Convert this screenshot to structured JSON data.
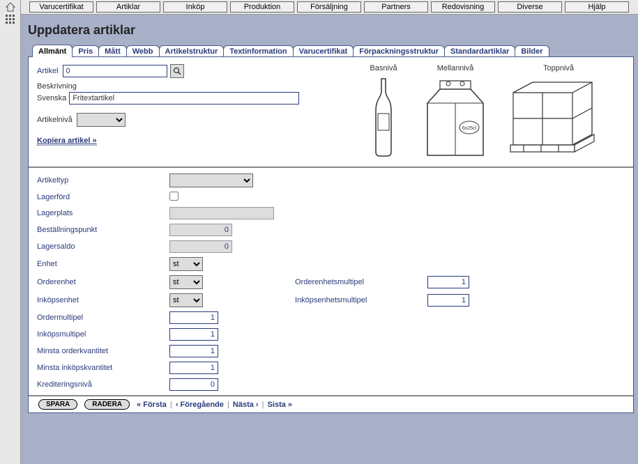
{
  "menubar": [
    "Varucertifikat",
    "Artiklar",
    "Inköp",
    "Produktion",
    "Försäljning",
    "Partners",
    "Redovisning",
    "Diverse",
    "Hjälp"
  ],
  "page_title": "Uppdatera artiklar",
  "tabs": [
    "Allmänt",
    "Pris",
    "Mått",
    "Webb",
    "Artikelstruktur",
    "Textinformation",
    "Varucertifikat",
    "Förpackningsstruktur",
    "Standardartiklar",
    "Bilder"
  ],
  "active_tab_index": 0,
  "upper": {
    "artikel_label": "Artikel",
    "artikel_value": "0",
    "beskrivning_label": "Beskrivning",
    "svenska_label": "Svenska",
    "svenska_value": "Fritextartikel",
    "artikelniva_label": "Artikelnivå",
    "kopiera_link": "Kopiera artikel »"
  },
  "levels": {
    "bas": "Basnivå",
    "mellan": "Mellannivå",
    "topp": "Toppnivå"
  },
  "fields": {
    "artikeltyp": {
      "label": "Artikeltyp"
    },
    "lagerford": {
      "label": "Lagerförd",
      "checked": false
    },
    "lagerplats": {
      "label": "Lagerplats",
      "value": ""
    },
    "bestallningspunkt": {
      "label": "Beställningspunkt",
      "value": "0"
    },
    "lagersaldo": {
      "label": "Lagersaldo",
      "value": "0"
    },
    "enhet": {
      "label": "Enhet",
      "value": "st"
    },
    "orderenhet": {
      "label": "Orderenhet",
      "value": "st"
    },
    "inkopsenhet": {
      "label": "Inköpsenhet",
      "value": "st"
    },
    "orderenhetsmultipel": {
      "label": "Orderenhetsmultipel",
      "value": "1"
    },
    "inkopsenhetsmultipel": {
      "label": "Inköpsenhetsmultipel",
      "value": "1"
    },
    "ordermultipel": {
      "label": "Ordermultipel",
      "value": "1"
    },
    "inkopsmultipel": {
      "label": "Inköpsmultipel",
      "value": "1"
    },
    "minsta_orderkvantitet": {
      "label": "Minsta orderkvantitet",
      "value": "1"
    },
    "minsta_inkopskvantitet": {
      "label": "Minsta inköpskvantitet",
      "value": "1"
    },
    "krediteringsniva": {
      "label": "Krediteringsnivå",
      "value": "0"
    }
  },
  "footer": {
    "save": "SPARA",
    "delete": "RADERA",
    "first": "« Första",
    "prev": "‹ Föregående",
    "next": "Nästa ›",
    "last": "Sista »"
  }
}
